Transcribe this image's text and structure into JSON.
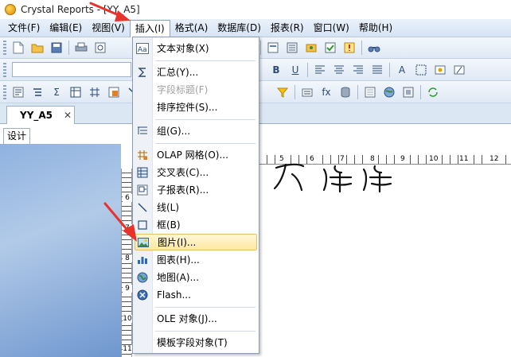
{
  "window": {
    "title": "Crystal Reports - [YY_A5]"
  },
  "menubar": {
    "items": [
      {
        "label": "文件(F)"
      },
      {
        "label": "编辑(E)"
      },
      {
        "label": "视图(V)"
      },
      {
        "label": "插入(I)"
      },
      {
        "label": "格式(A)"
      },
      {
        "label": "数据库(D)"
      },
      {
        "label": "报表(R)"
      },
      {
        "label": "窗口(W)"
      },
      {
        "label": "帮助(H)"
      }
    ]
  },
  "toolbar": {
    "bold": "B",
    "underline": "U",
    "sum": "Σ",
    "text_a": "A",
    "fx": "fx"
  },
  "document_tab": {
    "label": "YY_A5",
    "close": "✕"
  },
  "design_tab": {
    "label": "设计"
  },
  "ruler": {
    "vertical": [
      "6",
      "7",
      "8",
      "9",
      "10",
      "11"
    ],
    "horizontal": [
      "5",
      "6",
      "7",
      "8",
      "9",
      "10",
      "11",
      "12"
    ]
  },
  "insert_menu": {
    "items": [
      {
        "label": "文本对象(X)",
        "icon": "text-object-icon"
      },
      {
        "label": "汇总(Y)...",
        "icon": "sigma-icon"
      },
      {
        "label": "字段标题(F)",
        "icon": "",
        "disabled": true
      },
      {
        "label": "排序控件(S)...",
        "icon": ""
      },
      {
        "label": "组(G)...",
        "icon": "group-icon"
      },
      {
        "label": "OLAP 网格(O)...",
        "icon": "olap-grid-icon"
      },
      {
        "label": "交叉表(C)...",
        "icon": "crosstab-icon"
      },
      {
        "label": "子报表(R)...",
        "icon": "subreport-icon"
      },
      {
        "label": "线(L)",
        "icon": "line-icon"
      },
      {
        "label": "框(B)",
        "icon": "box-icon"
      },
      {
        "label": "图片(I)...",
        "icon": "picture-icon",
        "highlighted": true
      },
      {
        "label": "图表(H)...",
        "icon": "chart-icon"
      },
      {
        "label": "地图(A)...",
        "icon": "map-icon"
      },
      {
        "label": "Flash...",
        "icon": "flash-icon"
      },
      {
        "label": "OLE 对象(J)...",
        "icon": ""
      },
      {
        "label": "模板字段对象(T)",
        "icon": ""
      }
    ]
  },
  "colors": {
    "accent_arrow": "#e8322b",
    "menu_highlight": "#fde7a1"
  }
}
